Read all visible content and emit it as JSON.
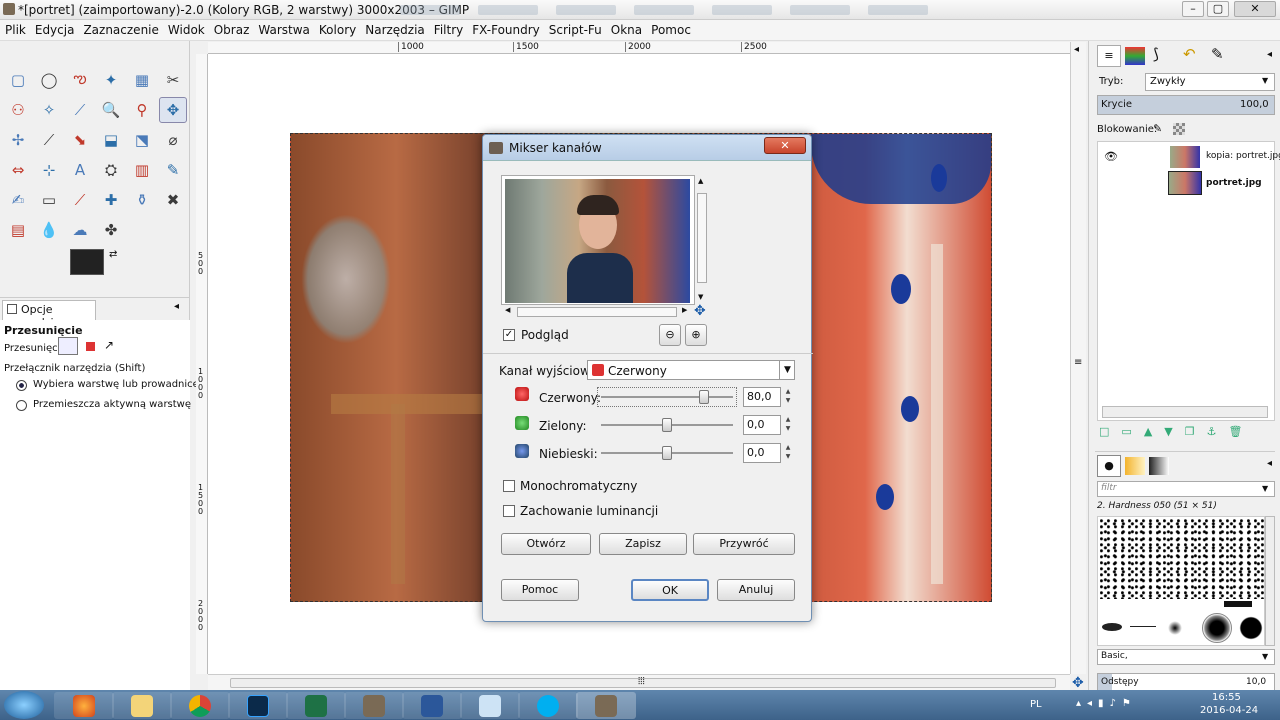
{
  "window": {
    "title": "*[portret] (zaimportowany)-2.0 (Kolory RGB, 2 warstwy) 3000x2003 – GIMP",
    "min": "–",
    "max": "▢",
    "close": "✕"
  },
  "menu": [
    "Plik",
    "Edycja",
    "Zaznaczenie",
    "Widok",
    "Obraz",
    "Warstwa",
    "Kolory",
    "Narzędzia",
    "Filtry",
    "FX-Foundry",
    "Script-Fu",
    "Okna",
    "Pomoc"
  ],
  "ruler": {
    "top": [
      "1000",
      "1500",
      "2000",
      "2500"
    ],
    "left": [
      "500",
      "1000",
      "1500",
      "2000"
    ]
  },
  "tool_options": {
    "tab": "Opcje narzędzia",
    "title": "Przesunięcie",
    "move_label": "Przesunięcie:",
    "switch_label": "Przełącznik narzędzia  (Shift)",
    "radio1": "Wybiera warstwę lub prowadnicę",
    "radio2": "Przemieszcza aktywną warstwę"
  },
  "dialog": {
    "title": "Mikser kanałów",
    "preview_label": "Podgląd",
    "output_label": "Kanał wyjściowy:",
    "output_value": "Czerwony",
    "red_label": "Czerwony:",
    "red_value": "80,0",
    "red_level": 0.8,
    "green_label": "Zielony:",
    "green_value": "0,0",
    "green_level": 0.5,
    "blue_label": "Niebieski:",
    "blue_value": "0,0",
    "blue_level": 0.5,
    "mono_label": "Monochromatyczny",
    "lum_label": "Zachowanie luminancji",
    "open_btn": "Otwórz",
    "save_btn": "Zapisz",
    "reset_btn": "Przywróć",
    "help_btn": "Pomoc",
    "ok_btn": "OK",
    "cancel_btn": "Anuluj"
  },
  "layers": {
    "mode_label": "Tryb:",
    "mode_value": "Zwykły",
    "opacity_label": "Krycie",
    "opacity_value": "100,0",
    "lock_label": "Blokowanie:",
    "items": [
      "kopia: portret.jpg",
      "portret.jpg"
    ]
  },
  "brushes": {
    "filter_placeholder": "filtr",
    "current": "2. Hardness 050 (51 × 51)",
    "tag": "Basic,",
    "spacing_label": "Odstępy",
    "spacing_value": "10,0"
  },
  "tray": {
    "lang": "PL",
    "time": "16:55",
    "date": "2016-04-24"
  },
  "colors": {
    "accent": "#3d6289",
    "dialog_border": "#6f8fb3",
    "close_red": "#c8442c"
  }
}
